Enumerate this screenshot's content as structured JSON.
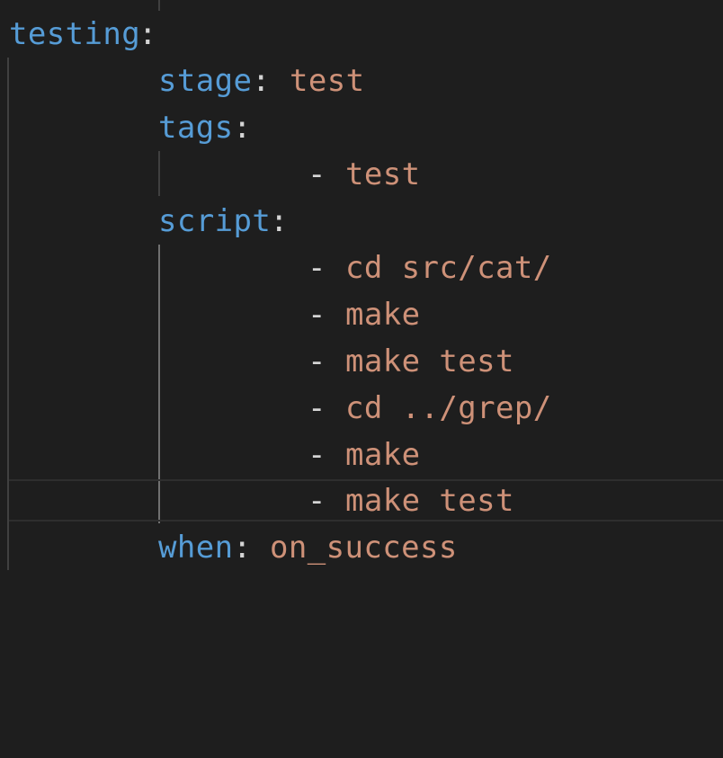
{
  "editor": {
    "colors": {
      "background": "#1e1e1e",
      "key": "#569cd6",
      "punctuation": "#d4d4d4",
      "string": "#ce9178",
      "indent_guide": "#404040",
      "indent_guide_active": "#707070",
      "current_line_border": "#2e2e2e"
    },
    "lines": [
      {
        "key": "testing",
        "colon": ":"
      },
      {
        "key": "stage",
        "colon": ":",
        "value": "test"
      },
      {
        "key": "tags",
        "colon": ":"
      },
      {
        "dash": "-",
        "value": "test"
      },
      {
        "key": "script",
        "colon": ":"
      },
      {
        "dash": "-",
        "value": "cd src/cat/"
      },
      {
        "dash": "-",
        "value": "make"
      },
      {
        "dash": "-",
        "value": "make test"
      },
      {
        "dash": "-",
        "value": "cd ../grep/"
      },
      {
        "dash": "-",
        "value": "make"
      },
      {
        "dash": "-",
        "value": "make test"
      },
      {
        "key": "when",
        "colon": ":",
        "value": "on_success"
      }
    ]
  }
}
